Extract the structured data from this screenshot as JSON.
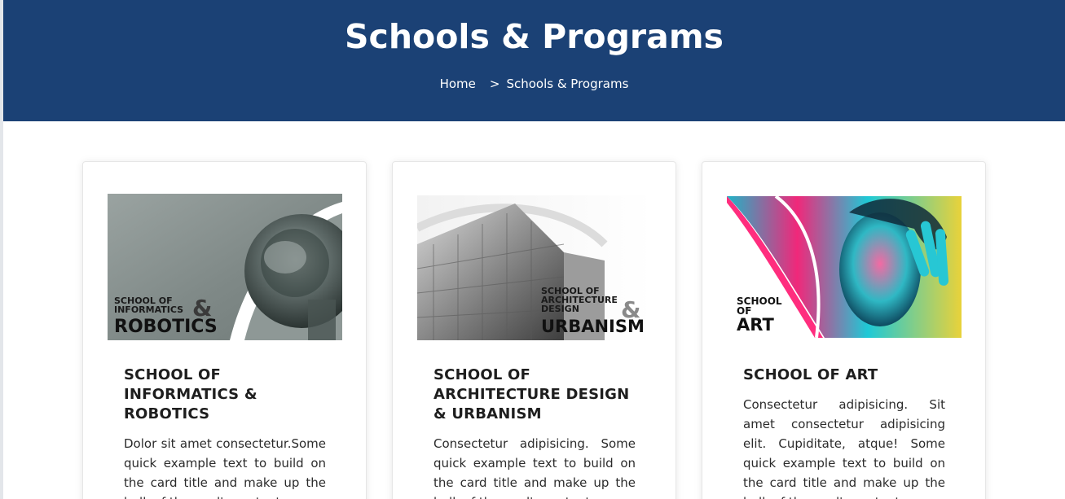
{
  "hero": {
    "title": "Schools & Programs",
    "breadcrumb": {
      "home": "Home",
      "separator": ">",
      "current": "Schools & Programs"
    }
  },
  "cards": [
    {
      "title": "SCHOOL OF INFORMATICS & ROBOTICS",
      "description": "Dolor sit amet consectetur.Some quick example text to build on the card title and make up the bulk of the card's content.",
      "image_text": {
        "line1": "SCHOOL OF",
        "line2": "INFORMATICS",
        "amp": "&",
        "line3": "ROBOTICS"
      }
    },
    {
      "title": "SCHOOL OF ARCHITECTURE DESIGN & URBANISM",
      "description": "Consectetur adipisicing. Some quick example text to build on the card title and make up the bulk of the card's content.",
      "image_text": {
        "line1": "SCHOOL OF",
        "line2": "ARCHITECTURE",
        "line3": "DESIGN",
        "amp": "&",
        "line4": "URBANISM"
      }
    },
    {
      "title": "SCHOOL OF ART",
      "description": "Consectetur adipisicing. Sit amet consectetur adipisicing elit. Cupiditate, atque! Some quick example text to build on the card title and make up the bulk of the card's content.",
      "image_text": {
        "line1": "SCHOOL",
        "line2": "OF",
        "line3": "ART"
      }
    }
  ],
  "colors": {
    "hero_bg": "#1b4175",
    "text_dark": "#1e1e1e"
  }
}
